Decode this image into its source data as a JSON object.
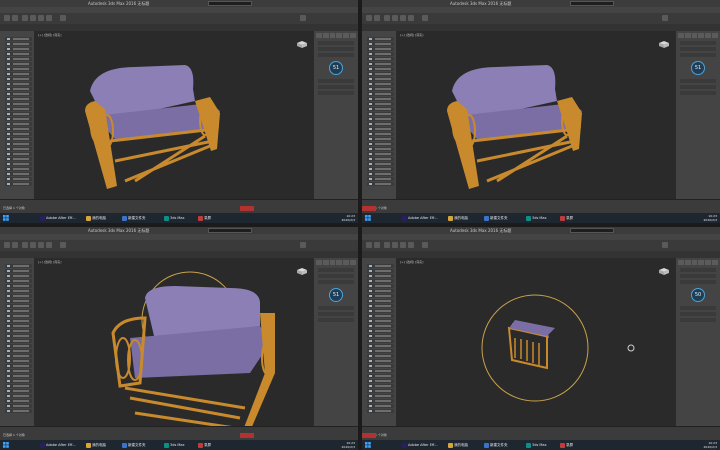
{
  "app_title": "Autodesk 3ds Max 2016   无标题",
  "viewport_label": "[+] [透视] [真实]",
  "gauge_values": [
    "51",
    "51",
    "51",
    "50"
  ],
  "status_text": "已选择 1 个对象",
  "taskbar": {
    "items": [
      {
        "label": "Adobe After Eff...",
        "color": "#2a1f5e"
      },
      {
        "label": "我的电脑",
        "color": "#d7a63a"
      },
      {
        "label": "新建文件夹",
        "color": "#3a73c9"
      },
      {
        "label": "3ds Max",
        "color": "#0e8f86"
      },
      {
        "label": "录屏",
        "color": "#c23b3b"
      }
    ],
    "time": "10:23",
    "date": "2020/2/3"
  },
  "colors": {
    "accent": "#4da3d8",
    "sofa_frame": "#c88a2c",
    "sofa_cushion": "#8b7fb5",
    "viewport_bg": "#2a2a2a"
  }
}
